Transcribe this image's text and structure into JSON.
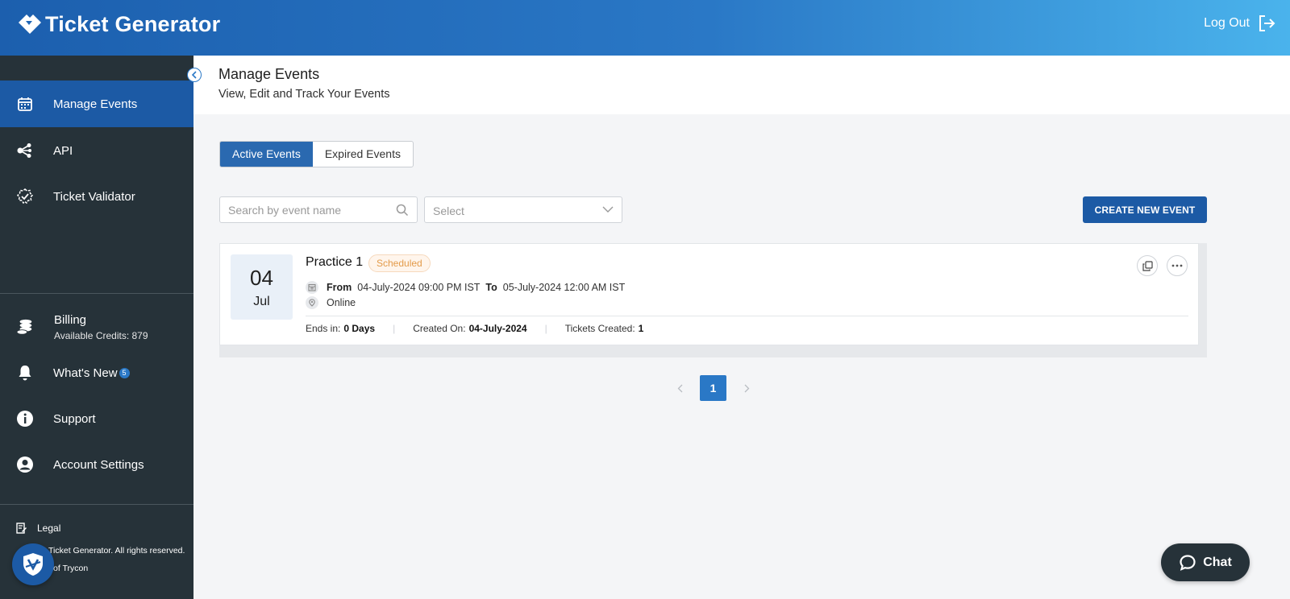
{
  "header": {
    "brand_name": "Ticket Generator",
    "logout_label": "Log Out"
  },
  "sidebar": {
    "main_items": [
      {
        "label": "Manage Events",
        "icon": "calendar-icon",
        "active": true
      },
      {
        "label": "API",
        "icon": "share-nodes-icon"
      },
      {
        "label": "Ticket Validator",
        "icon": "badge-check-icon"
      }
    ],
    "billing": {
      "label": "Billing",
      "sub": "Available Credits: 879",
      "icon": "coins-icon"
    },
    "whats_new": {
      "label": "What's New",
      "badge": "5",
      "icon": "bell-icon"
    },
    "support": {
      "label": "Support",
      "icon": "info-icon"
    },
    "account": {
      "label": "Account Settings",
      "icon": "user-circle-icon"
    },
    "legal": "Legal",
    "copyright": "Ticket Generator. All rights reserved.",
    "owner": "of Trycon"
  },
  "page": {
    "title": "Manage Events",
    "subtitle": "View, Edit and Track Your Events"
  },
  "tabs": [
    {
      "label": "Active Events",
      "active": true
    },
    {
      "label": "Expired Events",
      "active": false
    }
  ],
  "filters": {
    "search_placeholder": "Search by event name",
    "select_placeholder": "Select",
    "create_label": "CREATE NEW EVENT"
  },
  "events": [
    {
      "day": "04",
      "month": "Jul",
      "name": "Practice 1",
      "status": "Scheduled",
      "from_label": "From",
      "from": "04-July-2024 09:00 PM IST",
      "to_label": "To",
      "to": "05-July-2024 12:00 AM IST",
      "location": "Online",
      "ends_label": "Ends in:",
      "ends": "0 Days",
      "created_label": "Created On:",
      "created": "04-July-2024",
      "tickets_label": "Tickets Created:",
      "tickets": "1"
    }
  ],
  "pagination": {
    "current": "1"
  },
  "chat": {
    "label": "Chat"
  },
  "colors": {
    "primary": "#1c5aa5",
    "sidebar": "#263239",
    "accent": "#2a78c6",
    "status": "#e39b4a"
  }
}
